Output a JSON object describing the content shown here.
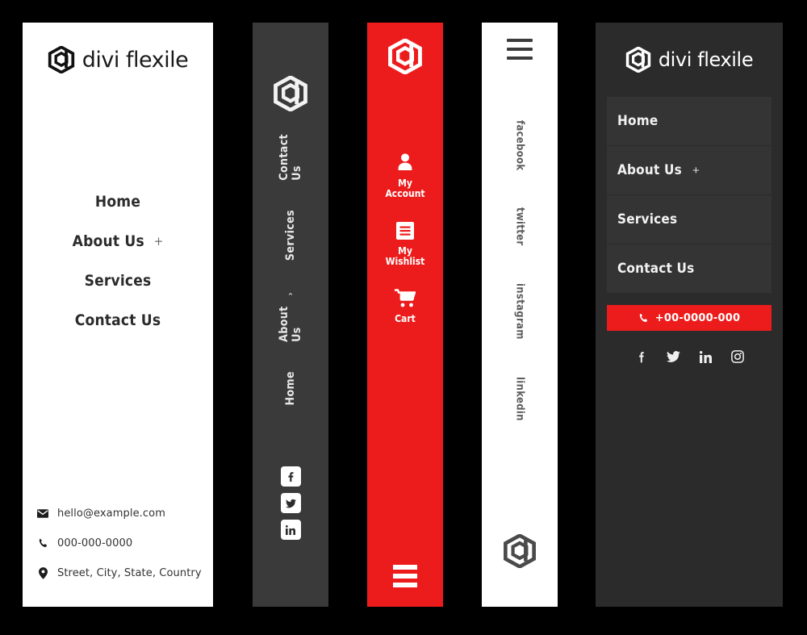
{
  "brand": {
    "name": "divi flexile",
    "logo_icon": "divi-hexagon-logo",
    "accent_color": "#ed1c1c"
  },
  "panels": {
    "white_menu": {
      "background": "#ffffff",
      "logo_text": "divi flexile",
      "nav": [
        {
          "label": "Home",
          "has_toggle": false,
          "toggle": ""
        },
        {
          "label": "About Us",
          "has_toggle": true,
          "toggle": "+"
        },
        {
          "label": "Services",
          "has_toggle": false,
          "toggle": ""
        },
        {
          "label": "Contact Us",
          "has_toggle": false,
          "toggle": ""
        }
      ],
      "contacts": [
        {
          "icon": "envelope-icon",
          "text": "hello@example.com"
        },
        {
          "icon": "phone-icon",
          "text": "000-000-0000"
        },
        {
          "icon": "map-pin-icon",
          "text": "Street, City, State, Country"
        }
      ]
    },
    "dark_rail": {
      "background": "#3a3a3a",
      "logo_icon": "divi-hexagon-logo",
      "nav": [
        {
          "label": "Home",
          "toggle": ""
        },
        {
          "label": "About Us",
          "toggle": "⌄"
        },
        {
          "label": "Services",
          "toggle": ""
        },
        {
          "label": "Contact Us",
          "toggle": ""
        }
      ],
      "social": [
        {
          "name": "facebook",
          "icon": "facebook-icon"
        },
        {
          "name": "twitter",
          "icon": "twitter-icon"
        },
        {
          "name": "linkedin",
          "icon": "linkedin-icon"
        }
      ]
    },
    "red_rail": {
      "background": "#ed1c1c",
      "logo_icon": "divi-hexagon-logo",
      "items": [
        {
          "icon": "user-icon",
          "line1": "My",
          "line2": "Account"
        },
        {
          "icon": "list-icon",
          "line1": "My",
          "line2": "Wishlist"
        },
        {
          "icon": "cart-icon",
          "line1": "Cart",
          "line2": ""
        }
      ],
      "menu_icon": "hamburger-icon"
    },
    "white_social_rail": {
      "background": "#ffffff",
      "menu_icon": "hamburger-icon",
      "social": [
        "facebook",
        "twitter",
        "instagram",
        "linkedin"
      ],
      "logo_icon": "divi-hexagon-logo"
    },
    "dark_menu": {
      "background": "#2b2b2b",
      "logo_text": "divi flexile",
      "nav": [
        {
          "label": "Home",
          "has_toggle": false,
          "toggle": ""
        },
        {
          "label": "About Us",
          "has_toggle": true,
          "toggle": "+"
        },
        {
          "label": "Services",
          "has_toggle": false,
          "toggle": ""
        },
        {
          "label": "Contact Us",
          "has_toggle": false,
          "toggle": ""
        }
      ],
      "phone_button": {
        "icon": "phone-icon",
        "label": "+00-0000-000",
        "color": "#ed1c1c"
      },
      "social": [
        {
          "name": "facebook",
          "icon": "facebook-icon"
        },
        {
          "name": "twitter",
          "icon": "twitter-icon"
        },
        {
          "name": "linkedin",
          "icon": "linkedin-icon"
        },
        {
          "name": "instagram",
          "icon": "instagram-icon"
        }
      ]
    }
  }
}
